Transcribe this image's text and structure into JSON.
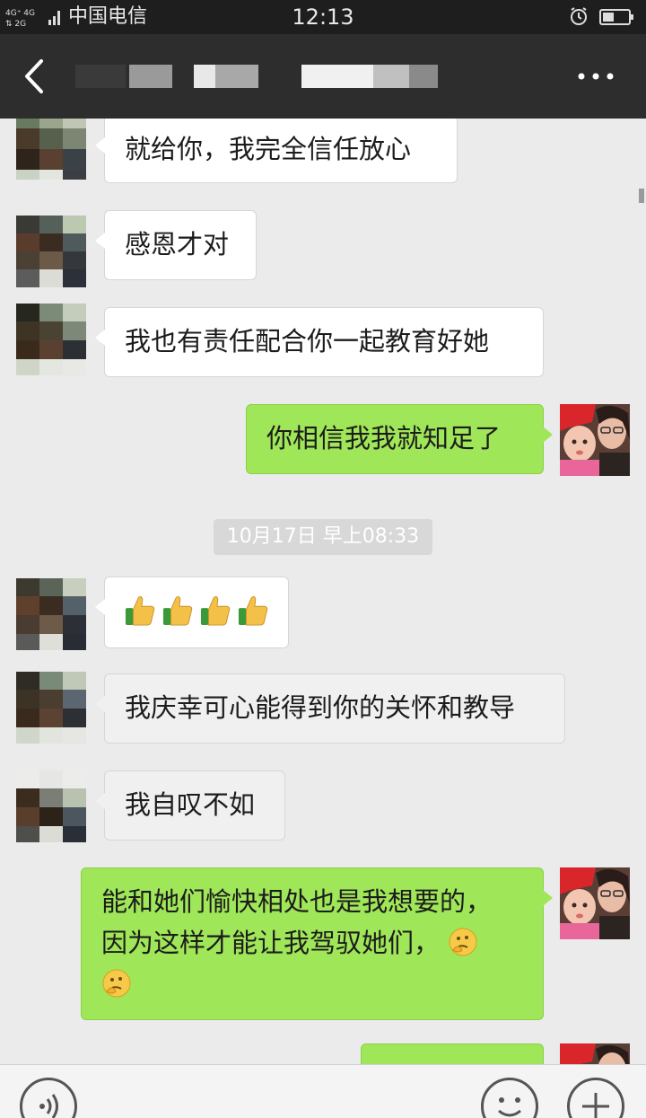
{
  "status_bar": {
    "network": "4G 4G 2G",
    "carrier": "中国电信",
    "time": "12:13",
    "icons": [
      "signal-icon",
      "alarm-icon",
      "battery-icon"
    ]
  },
  "nav": {
    "back_icon": "chevron-left-icon",
    "contact_name_visible": "",
    "more_icon": "more-dots-icon"
  },
  "messages": [
    {
      "side": "left",
      "text": "就给你，我完全信任放心"
    },
    {
      "side": "left",
      "text": "感恩才对"
    },
    {
      "side": "left",
      "text": "我也有责任配合你一起教育好她"
    },
    {
      "side": "right",
      "text": "你相信我我就知足了"
    },
    {
      "side": "left",
      "emoji": [
        "thumbs-up",
        "thumbs-up",
        "thumbs-up",
        "thumbs-up"
      ]
    },
    {
      "side": "left",
      "text": "我庆幸可心能得到你的关怀和教导"
    },
    {
      "side": "left",
      "text": "我自叹不如"
    },
    {
      "side": "right",
      "text_line1": "能和她们愉快相处也是我想要的，",
      "text_line2": "因为这样才能让我驾驭她们，",
      "trailing_emoji": "thinking-face"
    }
  ],
  "timestamp": "10月17日 早上08:33",
  "colors": {
    "status_bar": "#1e1e1e",
    "nav_bar": "#2d2d2d",
    "chat_bg": "#ebebeb",
    "sent_bubble": "#9fe658",
    "recv_bubble": "#ffffff"
  },
  "input_bar": {
    "left_icon": "voice-icon",
    "right_icons": [
      "emoji-icon",
      "plus-icon"
    ]
  }
}
